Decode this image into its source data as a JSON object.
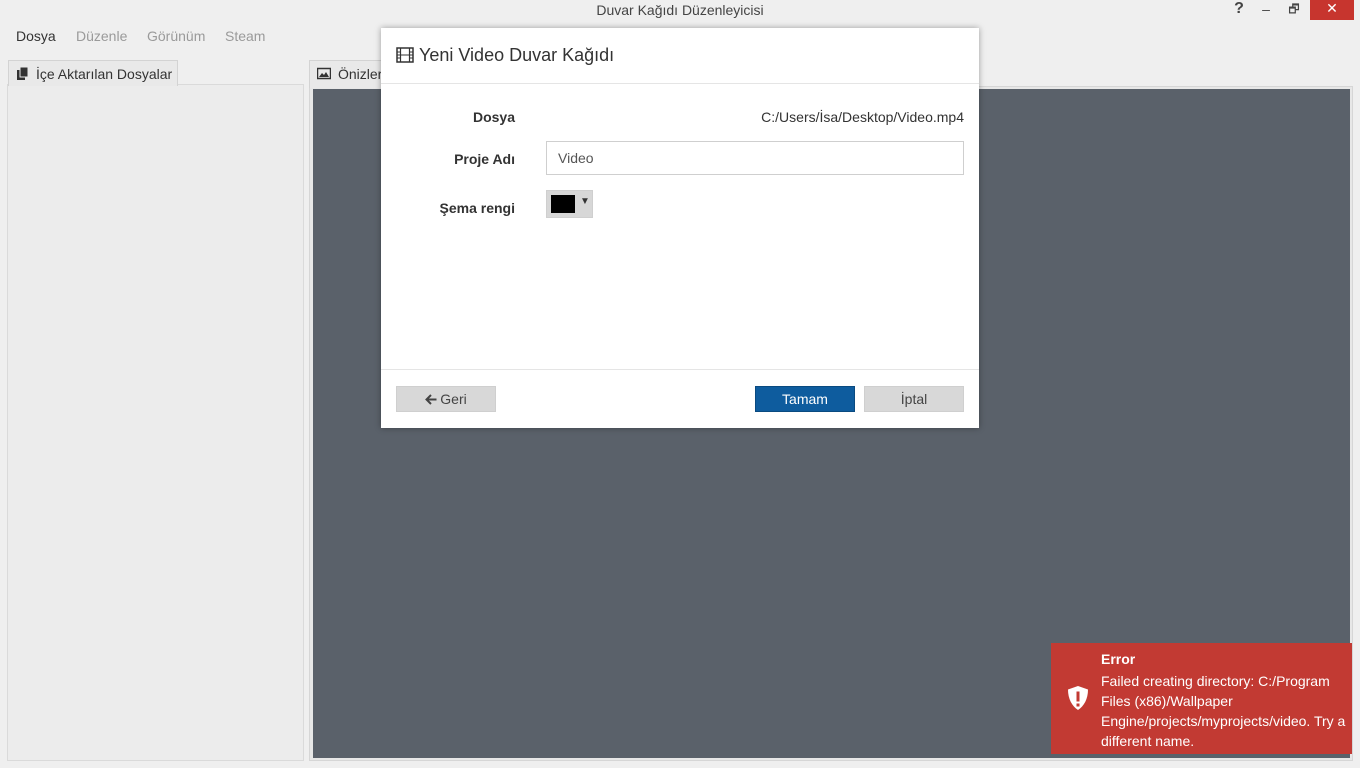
{
  "window": {
    "title": "Duvar Kağıdı Düzenleyicisi",
    "help_label": "?",
    "minimize_label": "–",
    "restore_label": "🗗",
    "close_label": "✕"
  },
  "menu": {
    "items": [
      "Dosya",
      "Düzenle",
      "Görünüm",
      "Steam"
    ]
  },
  "left_panel": {
    "tab_label": "İçe Aktarılan Dosyalar"
  },
  "preview_panel": {
    "tab_label": "Önizler"
  },
  "dialog": {
    "title": "Yeni Video Duvar Kağıdı",
    "file_label": "Dosya",
    "file_value": "C:/Users/İsa/Desktop/Video.mp4",
    "project_name_label": "Proje Adı",
    "project_name_value": "Video",
    "scheme_color_label": "Şema rengi",
    "scheme_color_value": "#000000",
    "back_label": "Geri",
    "ok_label": "Tamam",
    "cancel_label": "İptal"
  },
  "toast": {
    "title": "Error",
    "message": "Failed creating directory: C:/Program Files (x86)/Wallpaper Engine/projects/myprojects/video. Try a different name."
  },
  "colors": {
    "accent": "#0e5c9e",
    "error": "#c23a33",
    "preview_bg": "#5a616a"
  },
  "icons": {
    "dialog_title": "film-icon",
    "back": "arrow-left-icon",
    "toast": "shield-alert-icon",
    "left_tab": "copy-icon",
    "preview_tab": "image-icon"
  }
}
